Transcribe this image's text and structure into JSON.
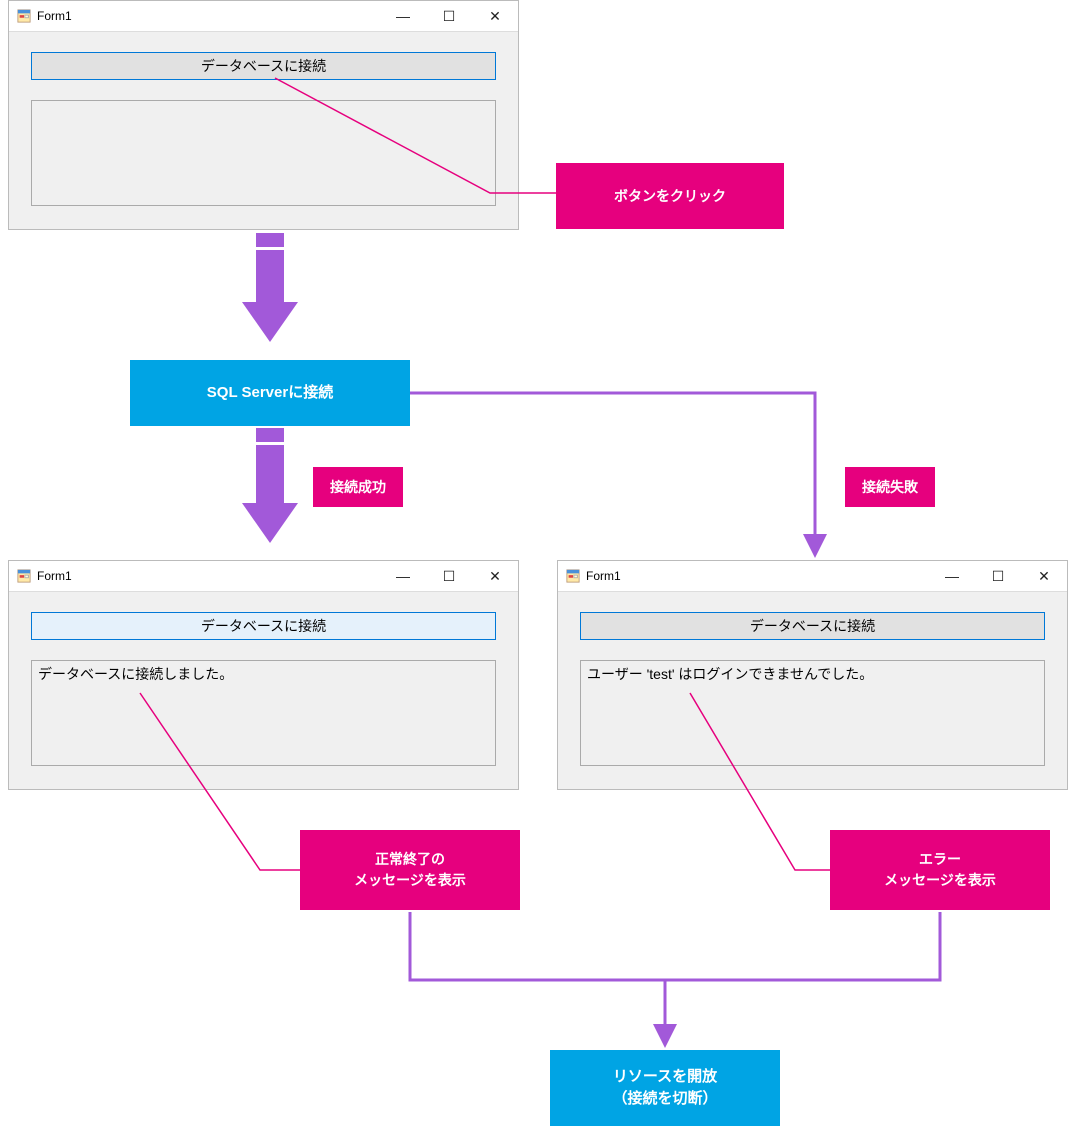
{
  "windows": {
    "top": {
      "title": "Form1",
      "button": "データベースに接続",
      "message": ""
    },
    "successWin": {
      "title": "Form1",
      "button": "データベースに接続",
      "message": "データベースに接続しました。"
    },
    "failWin": {
      "title": "Form1",
      "button": "データベースに接続",
      "message": "ユーザー 'test' はログインできませんでした。"
    }
  },
  "callouts": {
    "click": "ボタンをクリック",
    "successLabel": "接続成功",
    "failLabel": "接続失敗",
    "successMsg": "正常終了の\nメッセージを表示",
    "errorMsg": "エラー\nメッセージを表示"
  },
  "flow": {
    "sql": "SQL Serverに接続",
    "release": "リソースを開放\n（接続を切断）"
  }
}
